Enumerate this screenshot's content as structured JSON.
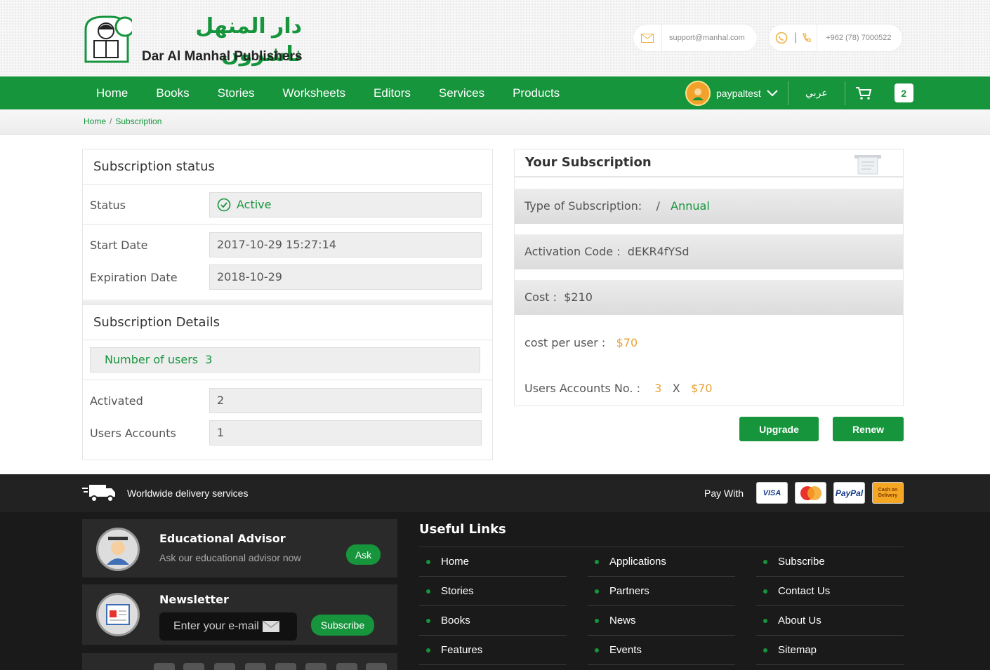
{
  "header": {
    "logo_arabic": "دار المنهل ناشرون",
    "logo_english": "Dar Al Manhal Publishers",
    "email": "support@manhal.com",
    "phone": "+962 (78) 7000522",
    "phone_divider": "|"
  },
  "nav": {
    "items": [
      "Home",
      "Books",
      "Stories",
      "Worksheets",
      "Editors",
      "Services",
      "Products"
    ],
    "user_name": "paypaltest",
    "language": "عربي",
    "cart_count": "2"
  },
  "breadcrumb": {
    "home": "Home",
    "separator": "/",
    "current": "Subscription"
  },
  "status_panel": {
    "title": "Subscription status",
    "status_label": "Status",
    "status_value": "Active",
    "start_label": "Start Date",
    "start_value": "2017-10-29 15:27:14",
    "expiration_label": "Expiration Date",
    "expiration_value": "2018-10-29",
    "details_title": "Subscription Details",
    "users_label": "Number of users",
    "users_value": "3",
    "activated_label": "Activated",
    "activated_value": "2",
    "accounts_label": "Users Accounts",
    "accounts_value": "1"
  },
  "your_subscription": {
    "title": "Your Subscription",
    "type_label": "Type of Subscription:",
    "type_sep": "/",
    "type_value": "Annual",
    "code_label": "Activation Code :",
    "code_value": "dEKR4fYSd",
    "cost_label": "Cost :",
    "cost_value": "$210",
    "per_user_label": "cost per user :",
    "per_user_value": "$70",
    "accounts_label": "Users Accounts No. :",
    "accounts_count": "3",
    "times": "X",
    "accounts_price": "$70",
    "upgrade_label": "Upgrade",
    "renew_label": "Renew"
  },
  "footer": {
    "delivery_text": "Worldwide delivery services",
    "pay_with": "Pay With",
    "cards": [
      "VISA",
      "MasterCard",
      "PayPal",
      "Cash on Delivery"
    ],
    "advisor_title": "Educational Advisor",
    "advisor_sub": "Ask our educational advisor now",
    "ask_label": "Ask",
    "newsletter_title": "Newsletter",
    "email_placeholder": "Enter your e-mail",
    "subscribe_label": "Subscribe",
    "useful_links_title": "Useful Links",
    "links_col1": [
      "Home",
      "Stories",
      "Books",
      "Features"
    ],
    "links_col2": [
      "Applications",
      "Partners",
      "News",
      "Events"
    ],
    "links_col3": [
      "Subscribe",
      "Contact Us",
      "About Us",
      "Sitemap"
    ]
  },
  "colors": {
    "brand_green": "#16953c",
    "accent_orange": "#e8a33a",
    "footer_dark": "#1a1a1a"
  }
}
